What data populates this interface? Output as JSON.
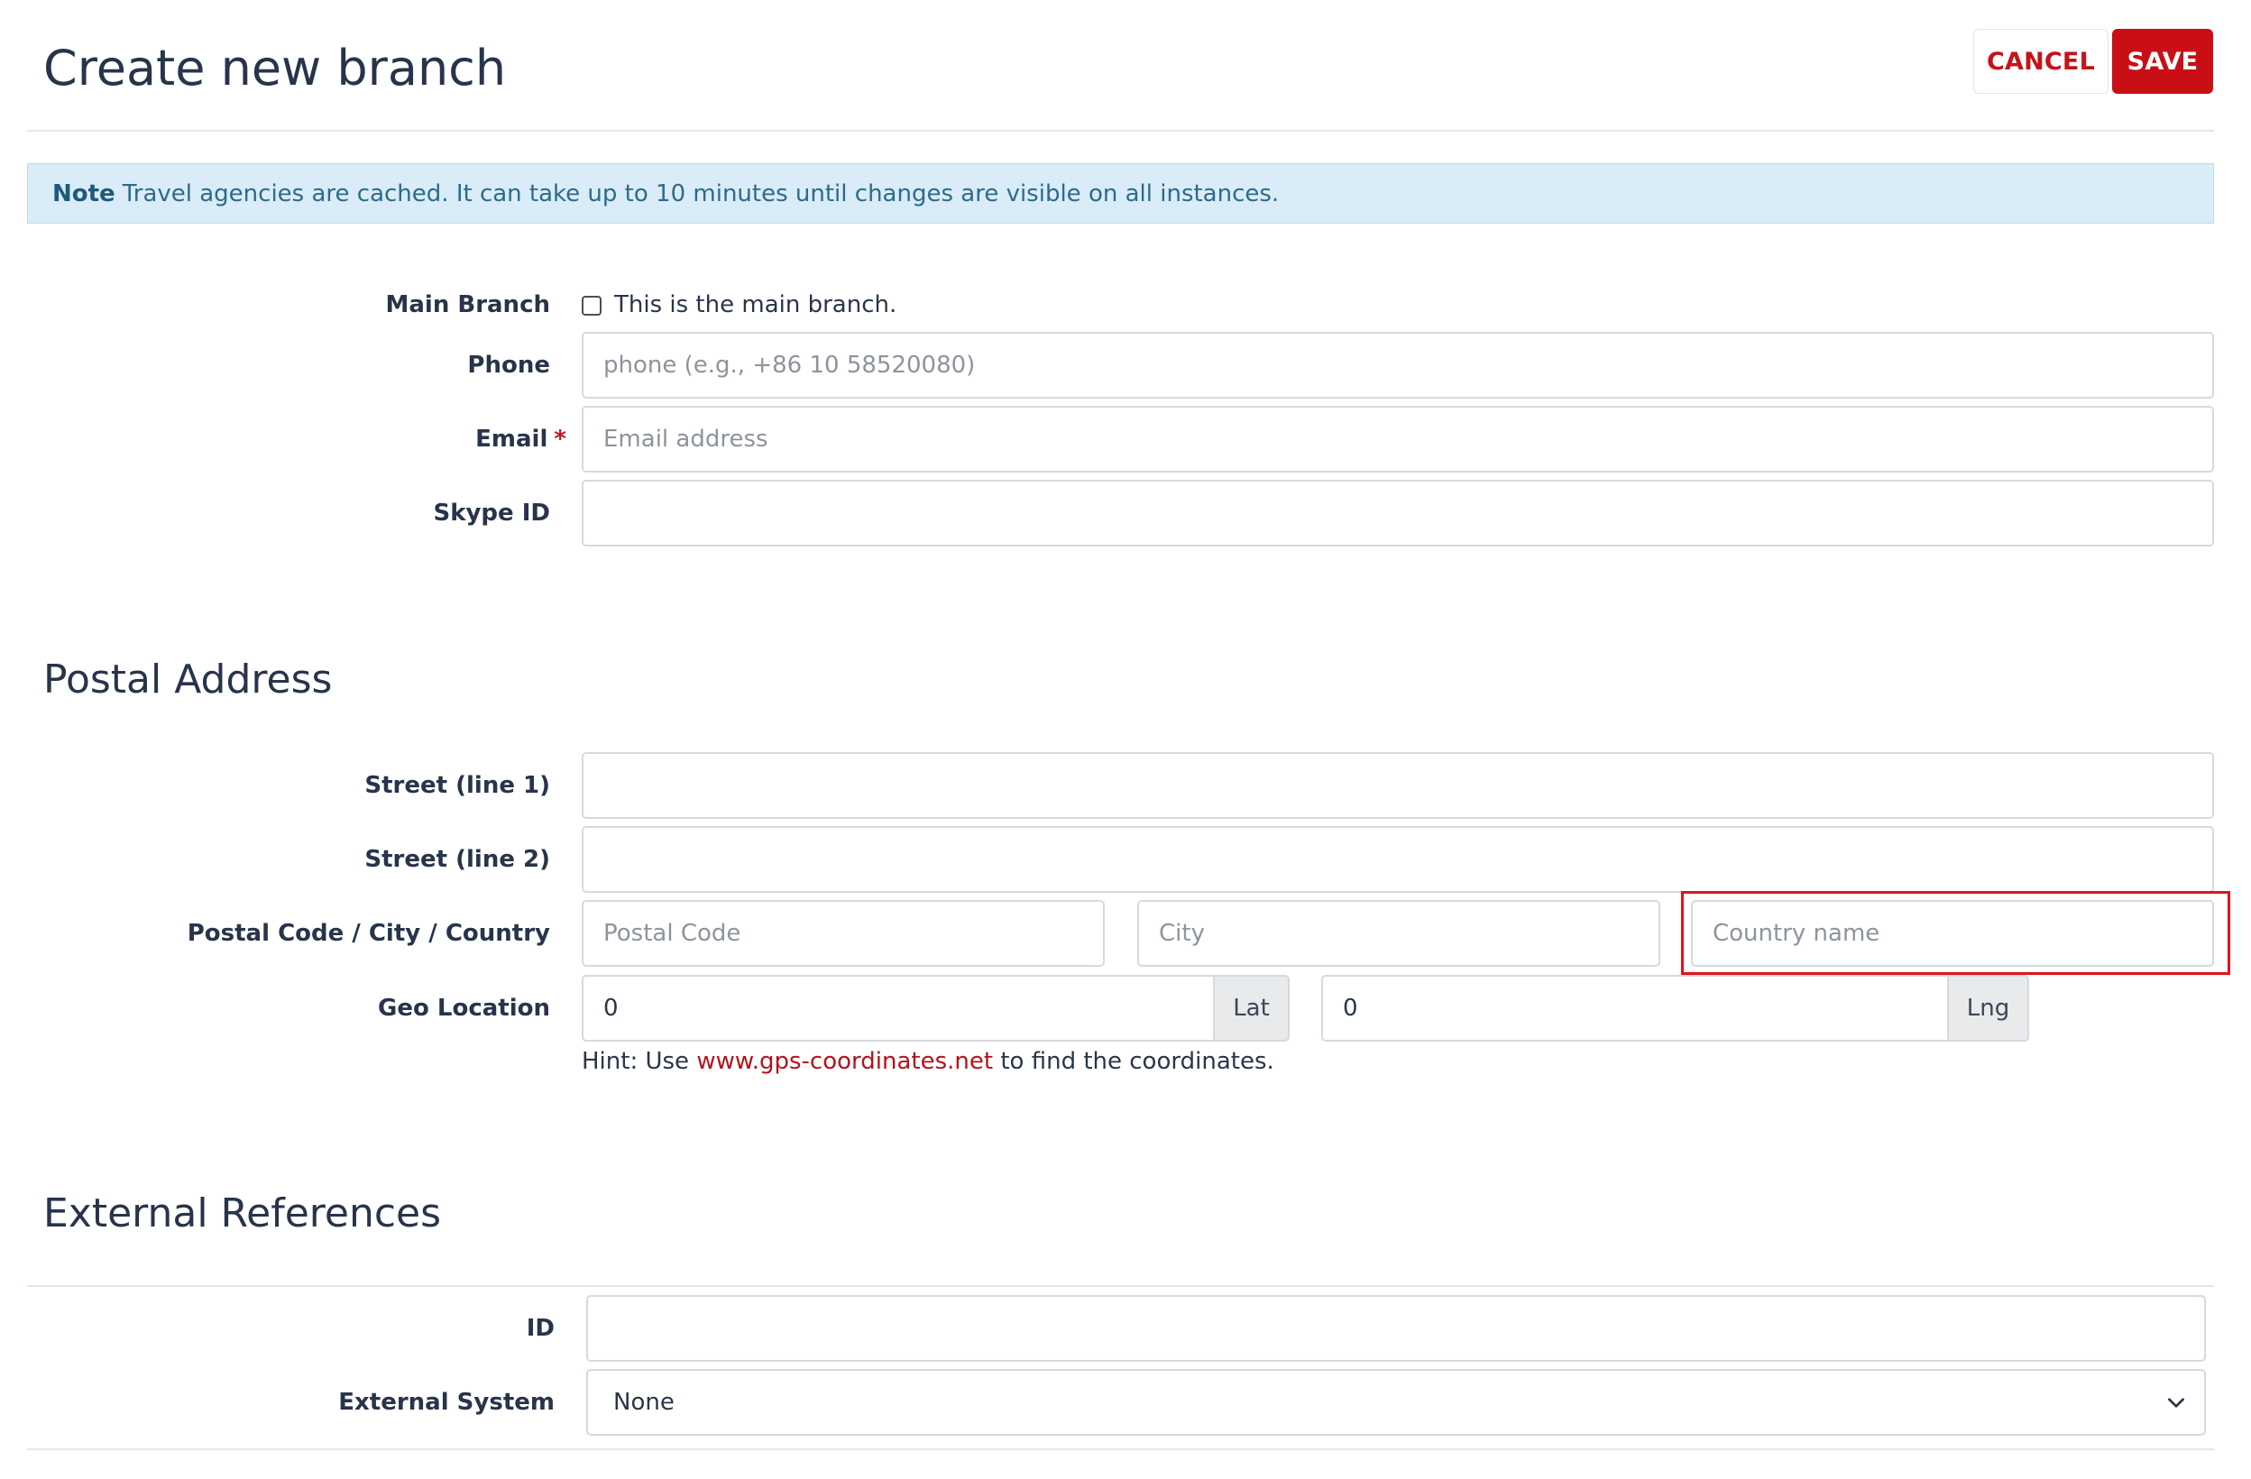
{
  "header": {
    "title": "Create new branch",
    "cancel_label": "CANCEL",
    "save_label": "SAVE"
  },
  "note": {
    "label": "Note",
    "text": "Travel agencies are cached. It can take up to 10 minutes until changes are visible on all instances."
  },
  "contact": {
    "main_branch_label": "Main Branch",
    "main_branch_checkbox_text": "This is the main branch.",
    "main_branch_checked": false,
    "phone_label": "Phone",
    "phone_placeholder": "phone (e.g., +86 10 58520080)",
    "phone_value": "",
    "email_label": "Email",
    "email_required_mark": "*",
    "email_placeholder": "Email address",
    "email_value": "",
    "skype_label": "Skype ID",
    "skype_value": ""
  },
  "postal": {
    "section_title": "Postal Address",
    "street1_label": "Street (line 1)",
    "street1_value": "",
    "street2_label": "Street (line 2)",
    "street2_value": "",
    "pcc_label": "Postal Code / City / Country",
    "postal_code_placeholder": "Postal Code",
    "city_placeholder": "City",
    "country_placeholder": "Country name",
    "geo_label": "Geo Location",
    "lat_value": "0",
    "lat_addon": "Lat",
    "lng_value": "0",
    "lng_addon": "Lng",
    "hint_prefix": "Hint: Use ",
    "hint_link": "www.gps-coordinates.net",
    "hint_suffix": " to find the coordinates."
  },
  "external": {
    "section_title": "External References",
    "id_label": "ID",
    "id_value": "",
    "system_label": "External System",
    "system_selected": "None"
  },
  "colors": {
    "accent_red": "#c90f15",
    "note_bg": "#d9ecf7",
    "highlight_border": "#e0141b"
  }
}
